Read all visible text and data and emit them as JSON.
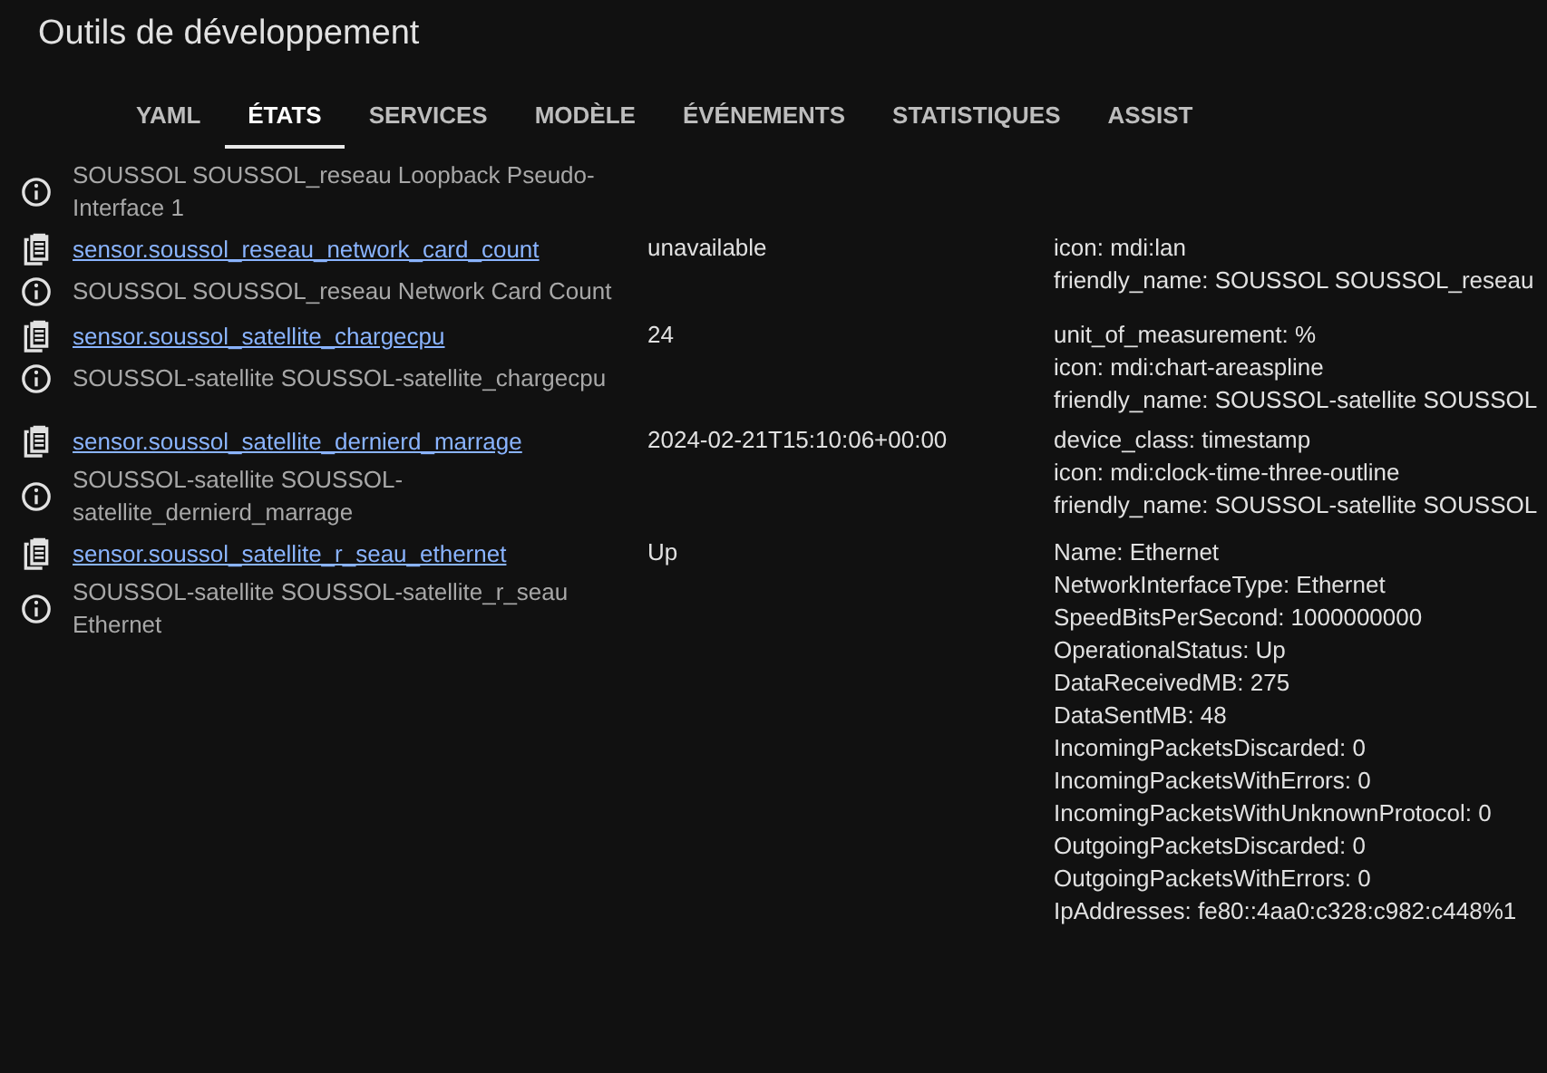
{
  "window": {
    "title": "Outils de développement"
  },
  "tabs": [
    {
      "label": "YAML",
      "selected": false
    },
    {
      "label": "ÉTATS",
      "selected": true
    },
    {
      "label": "SERVICES",
      "selected": false
    },
    {
      "label": "MODÈLE",
      "selected": false
    },
    {
      "label": "ÉVÉNEMENTS",
      "selected": false
    },
    {
      "label": "STATISTIQUES",
      "selected": false
    },
    {
      "label": "ASSIST",
      "selected": false
    }
  ],
  "entities": [
    {
      "friendly_name": "SOUSSOL SOUSSOL_reseau Loopback Pseudo-Interface 1"
    },
    {
      "entity_id": "sensor.soussol_reseau_network_card_count",
      "friendly_name": "SOUSSOL SOUSSOL_reseau Network Card Count",
      "state": "unavailable",
      "attributes": [
        "icon: mdi:lan",
        "friendly_name: SOUSSOL SOUSSOL_reseau"
      ]
    },
    {
      "entity_id": "sensor.soussol_satellite_chargecpu",
      "friendly_name": "SOUSSOL-satellite SOUSSOL-satellite_chargecpu",
      "state": "24",
      "attributes": [
        "unit_of_measurement: %",
        "icon: mdi:chart-areaspline",
        "friendly_name: SOUSSOL-satellite SOUSSOL"
      ]
    },
    {
      "entity_id": "sensor.soussol_satellite_dernierd_marrage",
      "friendly_name": "SOUSSOL-satellite SOUSSOL-satellite_dernierd_marrage",
      "state": "2024-02-21T15:10:06+00:00",
      "attributes": [
        "device_class: timestamp",
        "icon: mdi:clock-time-three-outline",
        "friendly_name: SOUSSOL-satellite SOUSSOL"
      ]
    },
    {
      "entity_id": "sensor.soussol_satellite_r_seau_ethernet",
      "friendly_name": "SOUSSOL-satellite SOUSSOL-satellite_r_seau Ethernet",
      "state": "Up",
      "attributes": [
        "Name: Ethernet",
        "NetworkInterfaceType: Ethernet",
        "SpeedBitsPerSecond: 1000000000",
        "OperationalStatus: Up",
        "DataReceivedMB: 275",
        "DataSentMB: 48",
        "IncomingPacketsDiscarded: 0",
        "IncomingPacketsWithErrors: 0",
        "IncomingPacketsWithUnknownProtocol: 0",
        "OutgoingPacketsDiscarded: 0",
        "OutgoingPacketsWithErrors: 0",
        "IpAddresses: fe80::4aa0:c328:c982:c448%1"
      ]
    }
  ]
}
